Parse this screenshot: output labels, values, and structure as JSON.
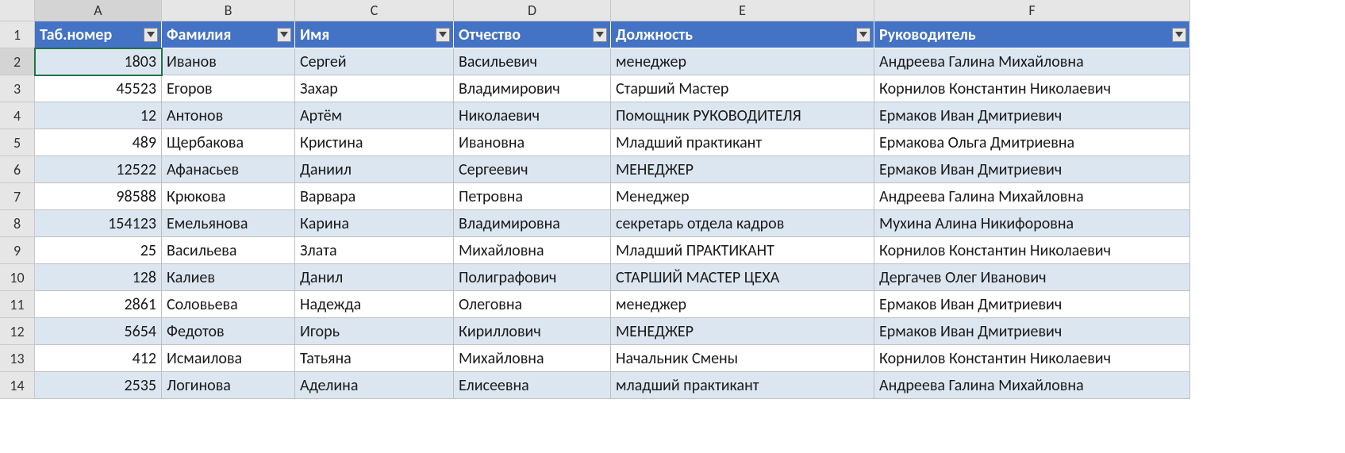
{
  "columns": [
    "A",
    "B",
    "C",
    "D",
    "E",
    "F"
  ],
  "row_numbers": [
    1,
    2,
    3,
    4,
    5,
    6,
    7,
    8,
    9,
    10,
    11,
    12,
    13,
    14
  ],
  "headers": [
    "Таб.номер",
    "Фамилия",
    "Имя",
    "Отчество",
    "Должность",
    "Руководитель"
  ],
  "selected_cell": "A2",
  "rows": [
    {
      "tab": "1803",
      "fam": "Иванов",
      "name": "Сергей",
      "otch": "Васильевич",
      "pos": "менеджер",
      "boss": "Андреева Галина Михайловна"
    },
    {
      "tab": "45523",
      "fam": "Егоров",
      "name": "Захар",
      "otch": "Владимирович",
      "pos": "Старший Мастер",
      "boss": "Корнилов Константин Николаевич"
    },
    {
      "tab": "12",
      "fam": "Антонов",
      "name": "Артём",
      "otch": "Николаевич",
      "pos": "Помощник РУКОВОДИТЕЛЯ",
      "boss": "Ермаков Иван Дмитриевич"
    },
    {
      "tab": "489",
      "fam": "Щербакова",
      "name": "Кристина",
      "otch": "Ивановна",
      "pos": "Младший практикант",
      "boss": "Ермакова Ольга Дмитриевна"
    },
    {
      "tab": "12522",
      "fam": "Афанасьев",
      "name": "Даниил",
      "otch": "Сергеевич",
      "pos": "МЕНЕДЖЕР",
      "boss": "Ермаков Иван Дмитриевич"
    },
    {
      "tab": "98588",
      "fam": "Крюкова",
      "name": "Варвара",
      "otch": "Петровна",
      "pos": "Менеджер",
      "boss": "Андреева Галина Михайловна"
    },
    {
      "tab": "154123",
      "fam": "Емельянова",
      "name": "Карина",
      "otch": "Владимировна",
      "pos": "секретарь отдела кадров",
      "boss": "Мухина Алина Никифоровна"
    },
    {
      "tab": "25",
      "fam": "Васильева",
      "name": "Злата",
      "otch": "Михайловна",
      "pos": "Младший ПРАКТИКАНТ",
      "boss": "Корнилов Константин Николаевич"
    },
    {
      "tab": "128",
      "fam": "Калиев",
      "name": "Данил",
      "otch": "Полиграфович",
      "pos": "СТАРШИЙ МАСТЕР ЦЕХА",
      "boss": "Дергачев Олег Иванович"
    },
    {
      "tab": "2861",
      "fam": "Соловьева",
      "name": "Надежда",
      "otch": "Олеговна",
      "pos": "менеджер",
      "boss": "Ермаков Иван Дмитриевич"
    },
    {
      "tab": "5654",
      "fam": "Федотов",
      "name": "Игорь",
      "otch": "Кириллович",
      "pos": "МЕНЕДЖЕР",
      "boss": "Ермаков Иван Дмитриевич"
    },
    {
      "tab": "412",
      "fam": "Исмаилова",
      "name": "Татьяна",
      "otch": "Михайловна",
      "pos": "Начальник Смены",
      "boss": "Корнилов Константин Николаевич"
    },
    {
      "tab": "2535",
      "fam": "Логинова",
      "name": "Аделина",
      "otch": "Елисеевна",
      "pos": "младший практикант",
      "boss": "Андреева Галина Михайловна"
    }
  ]
}
